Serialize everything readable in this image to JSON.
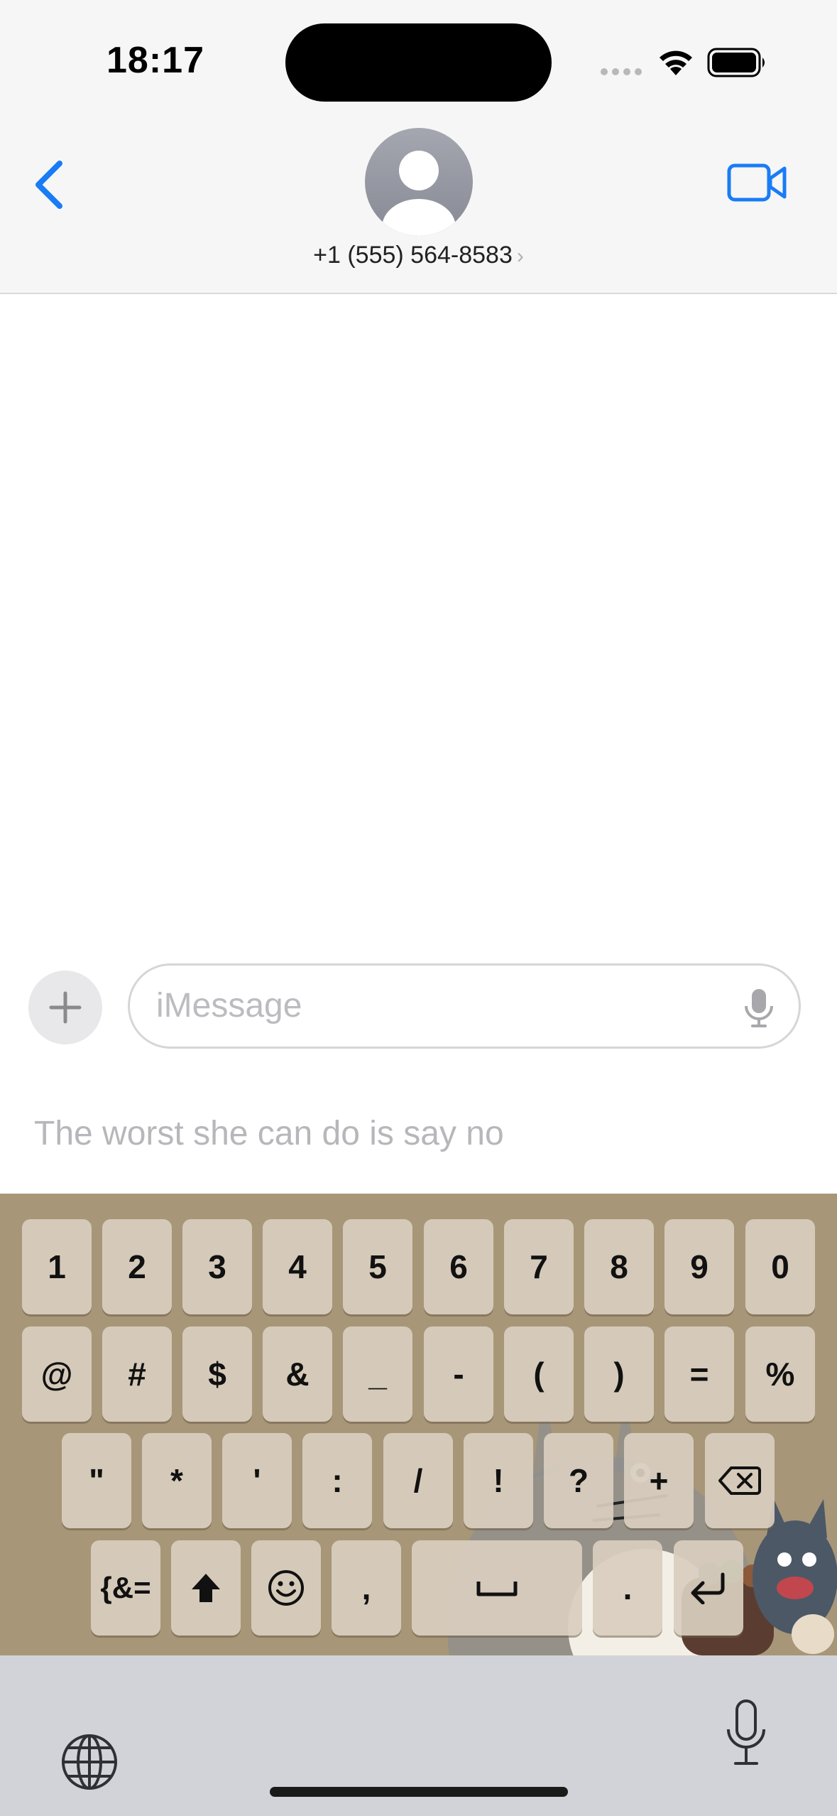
{
  "status_bar": {
    "time": "18:17"
  },
  "header": {
    "contact_number": "+1 (555) 564-8583",
    "contact_chevron": "›"
  },
  "composer": {
    "placeholder": "iMessage",
    "plus_label": "+"
  },
  "suggestion": {
    "text": "The worst she can do is say no"
  },
  "keyboard": {
    "row1": [
      "1",
      "2",
      "3",
      "4",
      "5",
      "6",
      "7",
      "8",
      "9",
      "0"
    ],
    "row2": [
      "@",
      "#",
      "$",
      "&",
      "_",
      "-",
      "(",
      ")",
      "=",
      "%"
    ],
    "row3": [
      "\"",
      "*",
      "'",
      ":",
      "/",
      "!",
      "?",
      "+"
    ],
    "row4": {
      "symbols_key": "{&=",
      "comma": ",",
      "period": "."
    }
  },
  "colors": {
    "accent": "#1a7cf5",
    "keyboard_bg": "#a89679",
    "key_bg": "#d8cebe"
  }
}
